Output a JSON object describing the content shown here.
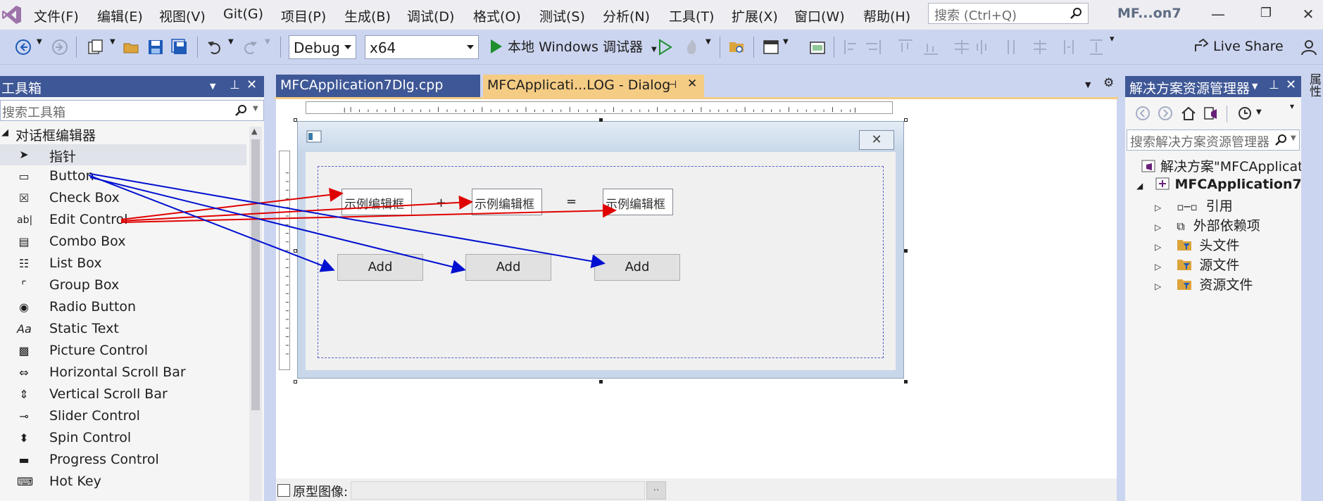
{
  "menu": {
    "items": [
      "文件(F)",
      "编辑(E)",
      "视图(V)",
      "Git(G)",
      "项目(P)",
      "生成(B)",
      "调试(D)",
      "格式(O)",
      "测试(S)",
      "分析(N)",
      "工具(T)",
      "扩展(X)",
      "窗口(W)",
      "帮助(H)"
    ],
    "search_placeholder": "搜索 (Ctrl+Q)",
    "window_title": "MF...on7"
  },
  "toolbar": {
    "configuration": "Debug",
    "platform": "x64",
    "debugger_label": "本地 Windows 调试器",
    "live_share": "Live Share"
  },
  "toolbox": {
    "title": "工具箱",
    "search_placeholder": "搜索工具箱",
    "group": "对话框编辑器",
    "items": [
      "指针",
      "Button",
      "Check Box",
      "Edit Control",
      "Combo Box",
      "List Box",
      "Group Box",
      "Radio Button",
      "Static Text",
      "Picture Control",
      "Horizontal Scroll Bar",
      "Vertical Scroll Bar",
      "Slider Control",
      "Spin Control",
      "Progress Control",
      "Hot Key"
    ]
  },
  "tabs": {
    "cpp": "MFCApplication7Dlg.cpp",
    "dialog": "MFCApplicati...LOG - Dialog"
  },
  "dialog": {
    "edit_placeholder": "示例编辑框",
    "plus": "+",
    "equals": "=",
    "button_label": "Add"
  },
  "designer": {
    "prototype_label": "原型图像:",
    "browse": ".."
  },
  "solution_explorer": {
    "title": "解决方案资源管理器",
    "search_placeholder": "搜索解决方案资源管理器",
    "solution": "解决方案\"MFCApplicatio",
    "project": "MFCApplication7",
    "nodes": [
      "引用",
      "外部依赖项",
      "头文件",
      "源文件",
      "资源文件"
    ]
  },
  "colors": {
    "accent": "#3E5796",
    "active_tab": "#F5CC84",
    "annotation_red": "#E00000",
    "annotation_blue": "#0010D0"
  }
}
